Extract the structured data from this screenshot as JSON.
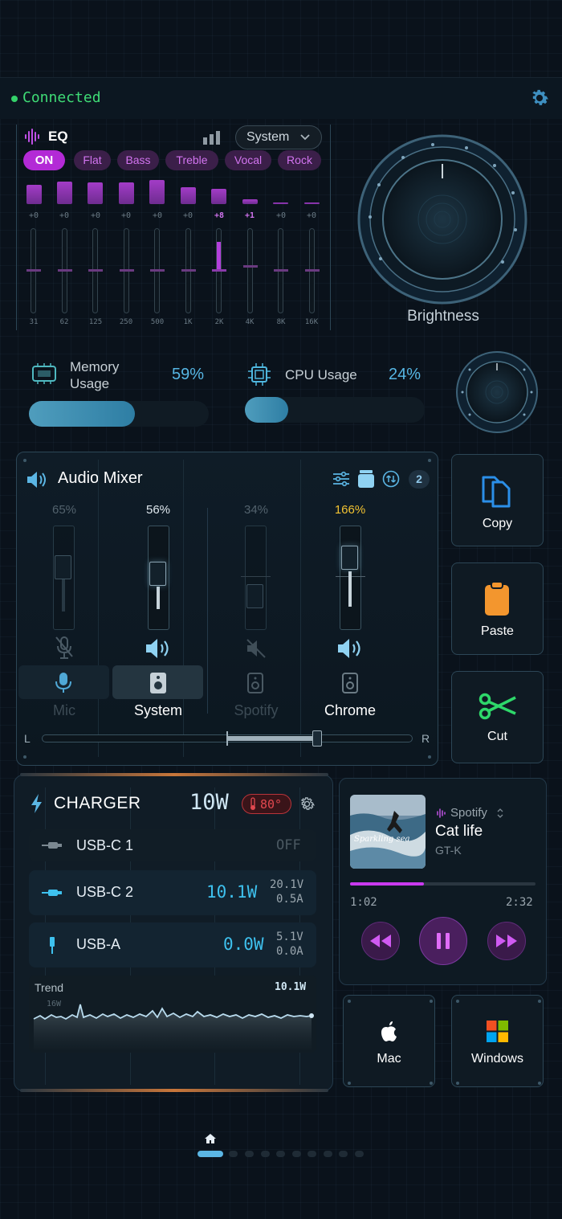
{
  "status": {
    "connection": "Connected"
  },
  "eq": {
    "title": "EQ",
    "dropdown_value": "System",
    "presets": [
      "ON",
      "Flat",
      "Bass",
      "Treble",
      "Vocal",
      "Rock"
    ],
    "values": [
      "+0",
      "+0",
      "+0",
      "+0",
      "+0",
      "+0",
      "+8",
      "+1",
      "+0",
      "+0"
    ],
    "freqs": [
      "31",
      "62",
      "125",
      "250",
      "500",
      "1K",
      "2K",
      "4K",
      "8K",
      "16K"
    ]
  },
  "brightness": {
    "label": "Brightness"
  },
  "memory": {
    "label_line1": "Memory",
    "label_line2": "Usage",
    "percent": "59%",
    "fill": 0.59
  },
  "cpu": {
    "label": "CPU Usage",
    "percent": "24%",
    "fill": 0.24
  },
  "mixer": {
    "title": "Audio Mixer",
    "badge": "2",
    "balance_left": "L",
    "balance_right": "R",
    "channels": [
      {
        "name": "Mic",
        "percent": "65%"
      },
      {
        "name": "System",
        "percent": "56%"
      },
      {
        "name": "Spotify",
        "percent": "34%"
      },
      {
        "name": "Chrome",
        "percent": "166%"
      }
    ]
  },
  "actions": {
    "copy": "Copy",
    "paste": "Paste",
    "cut": "Cut",
    "mac": "Mac",
    "windows": "Windows"
  },
  "charger": {
    "title": "CHARGER",
    "total": "10W",
    "temp": "80°",
    "ports": [
      {
        "name": "USB-C 1",
        "power": "OFF",
        "volt": "",
        "amp": ""
      },
      {
        "name": "USB-C 2",
        "power": "10.1W",
        "volt": "20.1V",
        "amp": "0.5A"
      },
      {
        "name": "USB-A",
        "power": "0.0W",
        "volt": "5.1V",
        "amp": "0.0A"
      }
    ],
    "trend_label": "Trend",
    "trend_value": "10.1W",
    "trend_scale": "16W"
  },
  "player": {
    "source": "Spotify",
    "title": "Cat life",
    "artist": "GT-K",
    "elapsed": "1:02",
    "duration": "2:32",
    "progress": 0.4,
    "art_text": "Sparkling sea"
  },
  "colors": {
    "accent_purple": "#b32ad6",
    "accent_blue": "#56b6e4",
    "connected_green": "#3fdc76"
  }
}
